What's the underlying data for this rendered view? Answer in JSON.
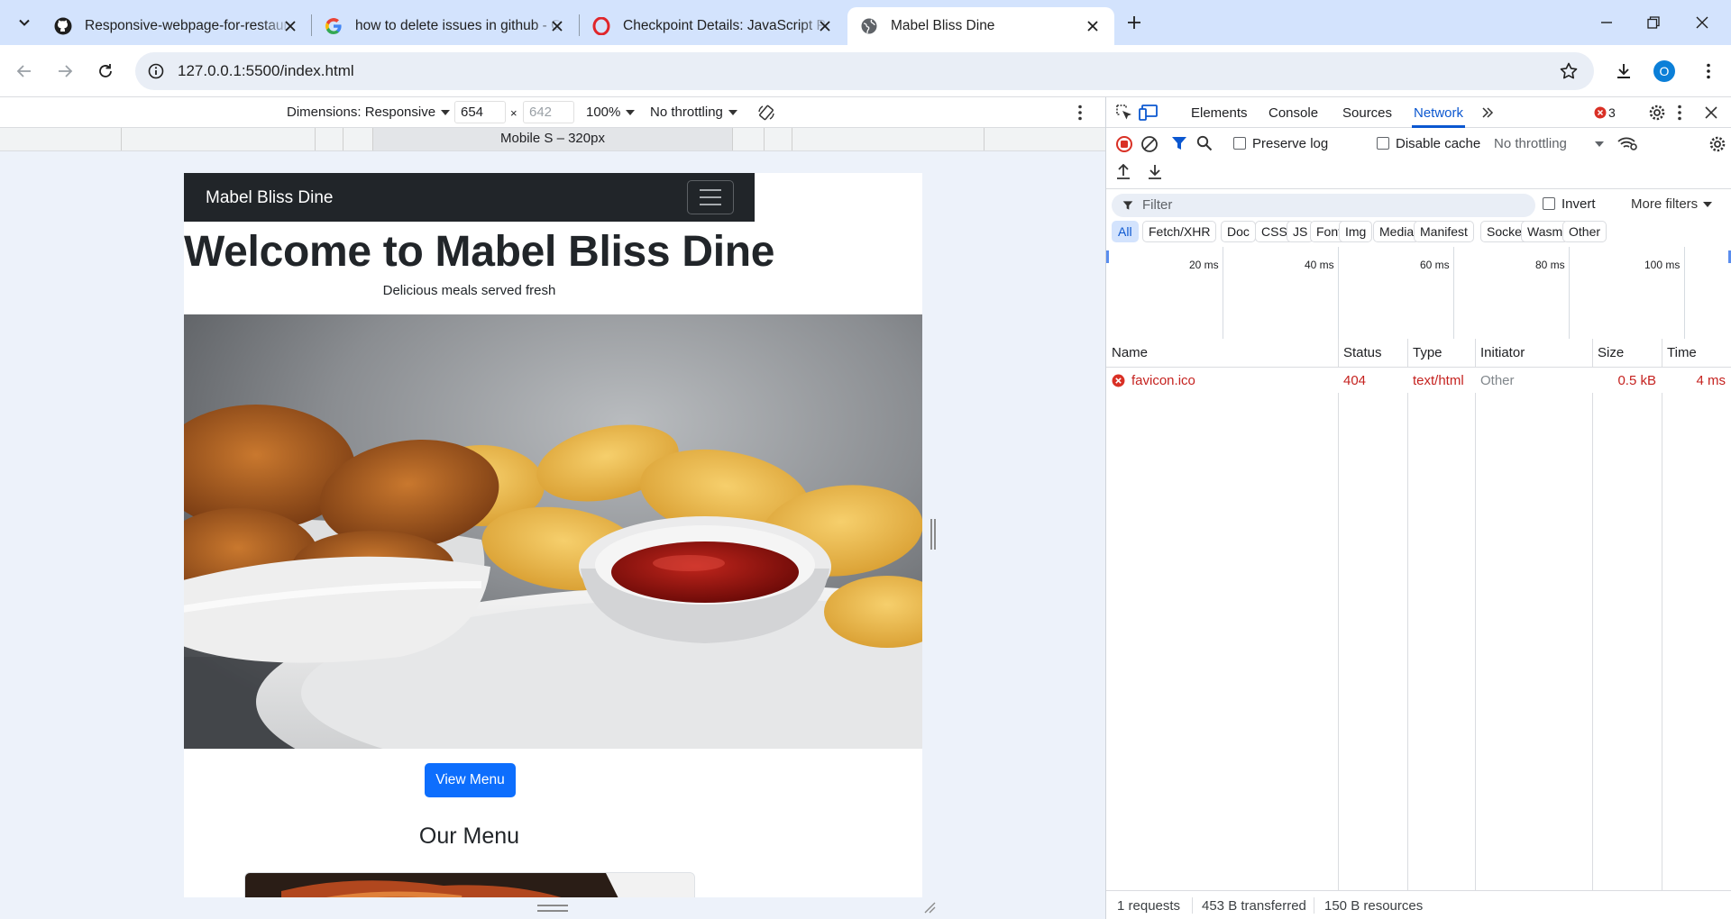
{
  "browser": {
    "tabs": [
      {
        "title": "Responsive-webpage-for-restaurant",
        "favicon": "github-icon"
      },
      {
        "title": "how to delete issues in github - Google Search",
        "favicon": "google-icon"
      },
      {
        "title": "Checkpoint Details: JavaScript Part",
        "favicon": "opera-icon"
      },
      {
        "title": "Mabel Bliss Dine",
        "favicon": "globe-icon",
        "active": true
      }
    ],
    "url": "127.0.0.1:5500/index.html",
    "profile_initial": "O"
  },
  "device_toolbar": {
    "dimensions": "Dimensions: Responsive",
    "width": "654",
    "height": "642",
    "zoom": "100%",
    "throttling": "No throttling",
    "media_query_label": "Mobile S – 320px"
  },
  "site": {
    "brand": "Mabel Bliss Dine",
    "heading": "Welcome to Mabel Bliss Dine",
    "subheading": "Delicious meals served fresh",
    "cta": "View Menu",
    "menu_heading": "Our Menu",
    "hero_alt": "Fried chicken with chips and ketchup"
  },
  "devtools": {
    "tabs": [
      "Elements",
      "Console",
      "Sources",
      "Network"
    ],
    "active_tab": "Network",
    "error_count": "3",
    "preserve_log": "Preserve log",
    "disable_cache": "Disable cache",
    "throttling": "No throttling",
    "filter_placeholder": "Filter",
    "invert": "Invert",
    "more_filters": "More filters",
    "filter_types": [
      "All",
      "Fetch/XHR",
      "Doc",
      "CSS",
      "JS",
      "Font",
      "Img",
      "Media",
      "Manifest",
      "Socket",
      "Wasm",
      "Other"
    ],
    "timeline_ticks": [
      "20 ms",
      "40 ms",
      "60 ms",
      "80 ms",
      "100 ms"
    ],
    "columns": [
      "Name",
      "Status",
      "Type",
      "Initiator",
      "Size",
      "Time"
    ],
    "requests": [
      {
        "name": "favicon.ico",
        "status": "404",
        "type": "text/html",
        "initiator": "Other",
        "size": "0.5 kB",
        "time": "4 ms"
      }
    ],
    "summary": {
      "requests": "1 requests",
      "transferred": "453 B transferred",
      "resources": "150 B resources"
    }
  },
  "colors": {
    "accent": "#0b57d0",
    "error": "#c5221f",
    "navbar": "#212529",
    "button": "#0d6efd"
  }
}
